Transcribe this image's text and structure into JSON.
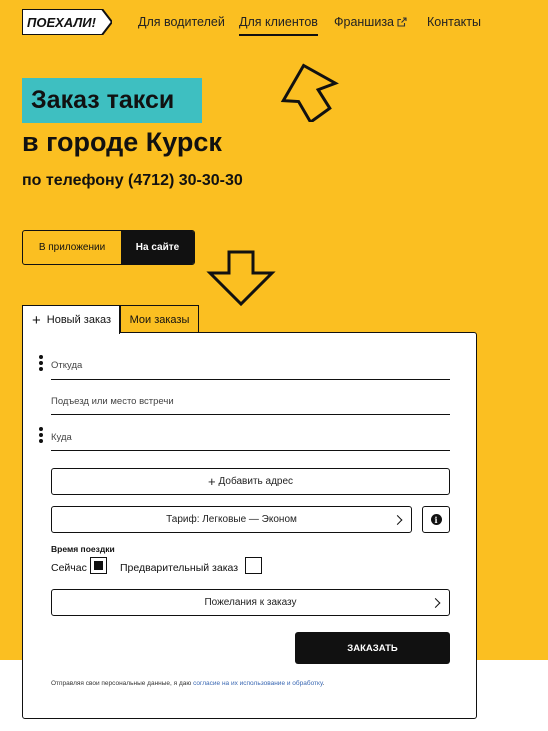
{
  "header": {
    "logo_text": "ПОЕХАЛИ!",
    "nav": [
      {
        "label": "Для водителей"
      },
      {
        "label": "Для клиентов"
      },
      {
        "label": "Франшиза"
      },
      {
        "label": "Контакты"
      }
    ],
    "active_nav": "Для клиентов"
  },
  "hero": {
    "highlight": "Заказ такси",
    "city": "в городе Курск",
    "phone": "по телефону (4712) 30-30-30"
  },
  "mode_toggle": {
    "app_label": "В приложении",
    "site_label": "На сайте",
    "selected": "На сайте"
  },
  "tabs": {
    "new_order": "Новый заказ",
    "my_orders": "Мои заказы",
    "active": "Новый заказ"
  },
  "form": {
    "from_placeholder": "Откуда",
    "entrance_placeholder": "Подъезд или место встречи",
    "to_placeholder": "Куда",
    "add_address": "Добавить адрес",
    "tariff": "Тариф: Легковые — Эконом",
    "time_title": "Время поездки",
    "now_label": "Сейчас",
    "now_checked": true,
    "preorder_label": "Предварительный заказ",
    "preorder_checked": false,
    "wishes": "Пожелания к заказу",
    "order_button": "ЗАКАЗАТЬ",
    "consent_text": "Отправляя свои персональные данные, я даю",
    "consent_link": "согласие на их использование и обработку",
    "consent_end": "."
  },
  "colors": {
    "brand_yellow": "#fbbf21",
    "highlight_teal": "#3ebfc1",
    "dark": "#111111",
    "link": "#3a68b3"
  },
  "icons": [
    "external-link-icon",
    "plus-icon",
    "drag-handle-icon",
    "info-icon",
    "chevron-right-icon"
  ]
}
